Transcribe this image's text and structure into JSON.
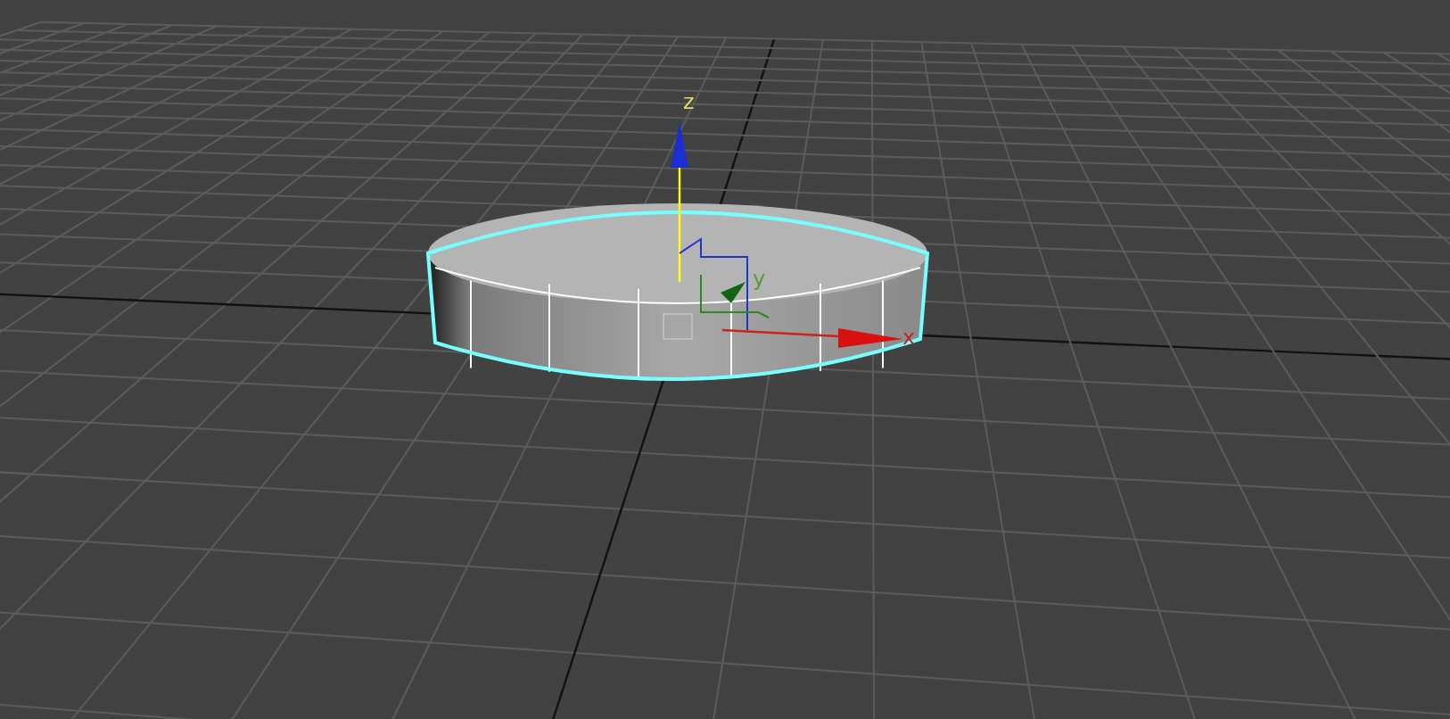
{
  "viewport": {
    "axis_labels": [
      {
        "kind": "z",
        "label": "z",
        "color": "#e6dc5a"
      },
      {
        "kind": "y",
        "label": "y",
        "color": "#5a9a3a"
      },
      {
        "kind": "x",
        "label": "x",
        "color": "#c02828"
      }
    ]
  }
}
